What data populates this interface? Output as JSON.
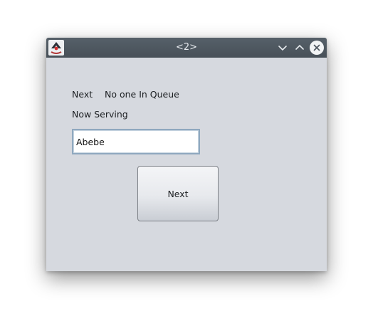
{
  "window": {
    "title": "<2>",
    "app_icon": "java-duke-icon"
  },
  "titlebar_buttons": {
    "minimize_icon": "chevron-down-icon",
    "maximize_icon": "chevron-up-icon",
    "close_icon": "close-icon"
  },
  "queue": {
    "next_label": "Next",
    "next_value": "No one In Queue",
    "now_serving_label": "Now Serving"
  },
  "name_field": {
    "value": "Abebe"
  },
  "next_button": {
    "label": "Next"
  },
  "colors": {
    "titlebar": "#4d565f",
    "window_bg": "#d6d9df",
    "field_border": "#8fa8bf"
  }
}
